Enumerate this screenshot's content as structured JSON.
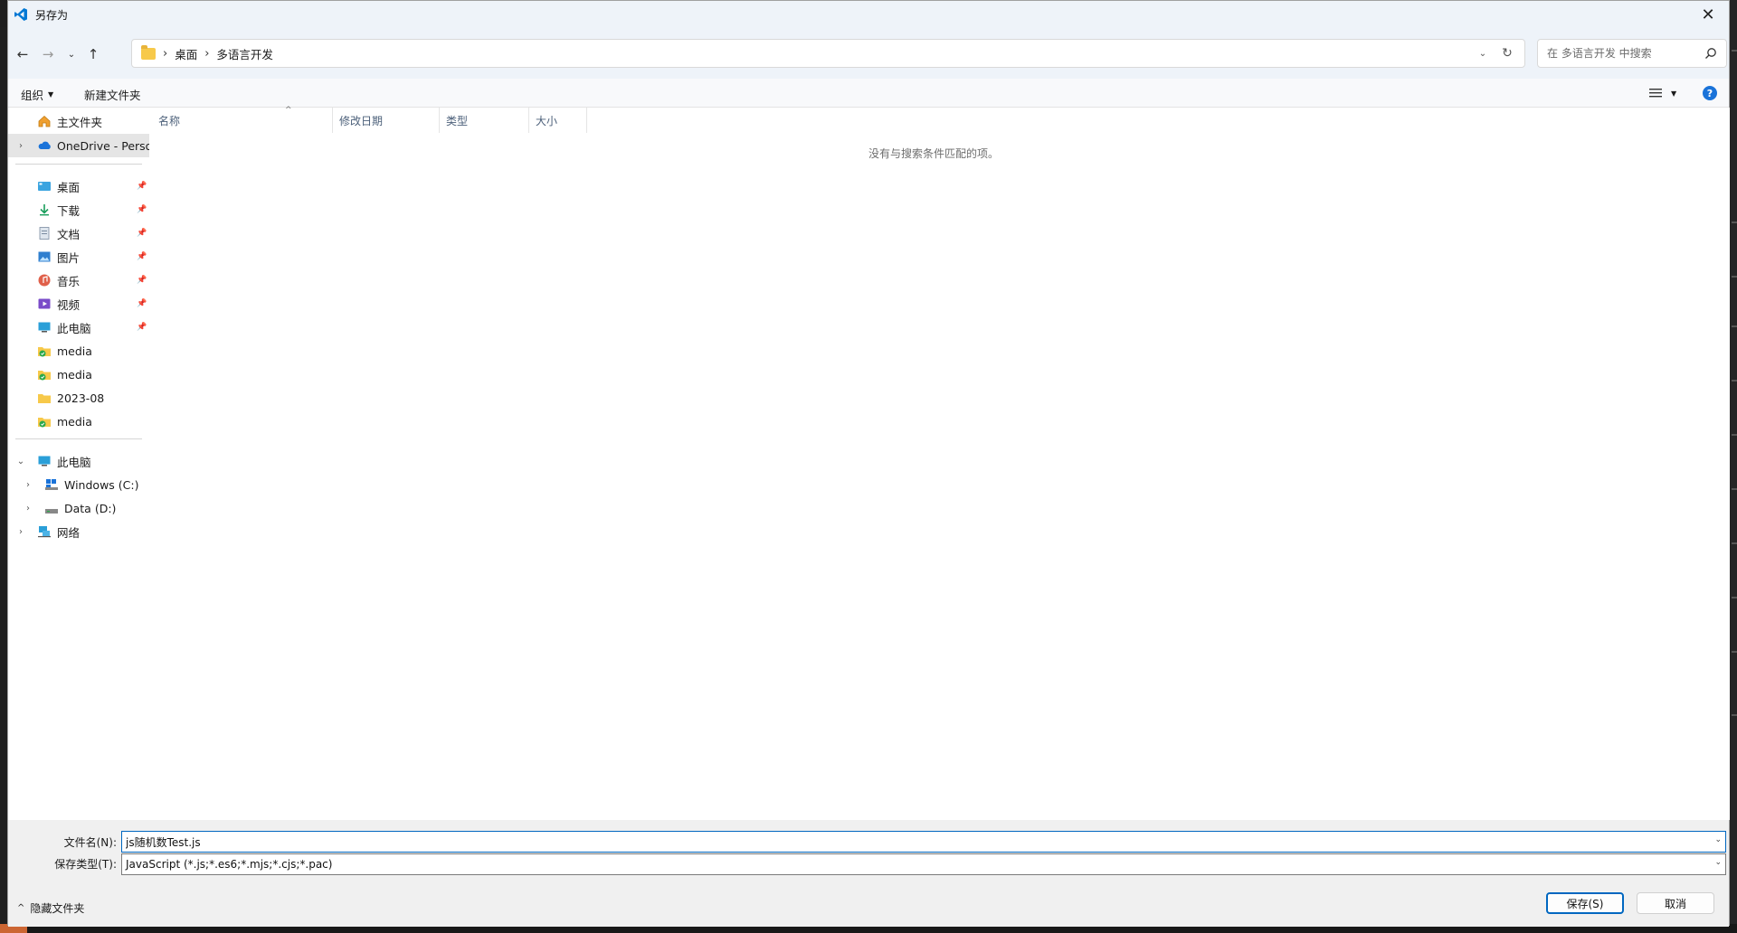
{
  "window": {
    "title": "另存为"
  },
  "address": {
    "crumbs": [
      "桌面",
      "多语言开发"
    ]
  },
  "search": {
    "placeholder": "在 多语言开发 中搜索"
  },
  "commands": {
    "organize": "组织",
    "new_folder": "新建文件夹"
  },
  "nav": {
    "home": "主文件夹",
    "onedrive": "OneDrive - Perso",
    "quick": [
      {
        "label": "桌面",
        "icon": "desktop-icon"
      },
      {
        "label": "下载",
        "icon": "download-icon"
      },
      {
        "label": "文档",
        "icon": "document-icon"
      },
      {
        "label": "图片",
        "icon": "pictures-icon"
      },
      {
        "label": "音乐",
        "icon": "music-icon"
      },
      {
        "label": "视频",
        "icon": "video-icon"
      },
      {
        "label": "此电脑",
        "icon": "computer-icon"
      },
      {
        "label": "media",
        "icon": "shared-folder-icon"
      },
      {
        "label": "media",
        "icon": "shared-folder-icon"
      },
      {
        "label": "2023-08",
        "icon": "folder-icon"
      },
      {
        "label": "media",
        "icon": "shared-folder-icon"
      }
    ],
    "this_pc": "此电脑",
    "drives": [
      "Windows (C:)",
      "Data (D:)"
    ],
    "network": "网络"
  },
  "columns": [
    "名称",
    "修改日期",
    "类型",
    "大小"
  ],
  "empty_message": "没有与搜索条件匹配的项。",
  "filename": {
    "label": "文件名(N):",
    "value": "js随机数Test.js"
  },
  "filetype": {
    "label": "保存类型(T):",
    "value": "JavaScript (*.js;*.es6;*.mjs;*.cjs;*.pac)"
  },
  "hide_folders": "隐藏文件夹",
  "buttons": {
    "save": "保存(S)",
    "cancel": "取消"
  },
  "colors": {
    "accent": "#0067c0",
    "help": "#1a73d9",
    "folder": "#f7c94a",
    "vscode_blue": "#0078d4"
  }
}
